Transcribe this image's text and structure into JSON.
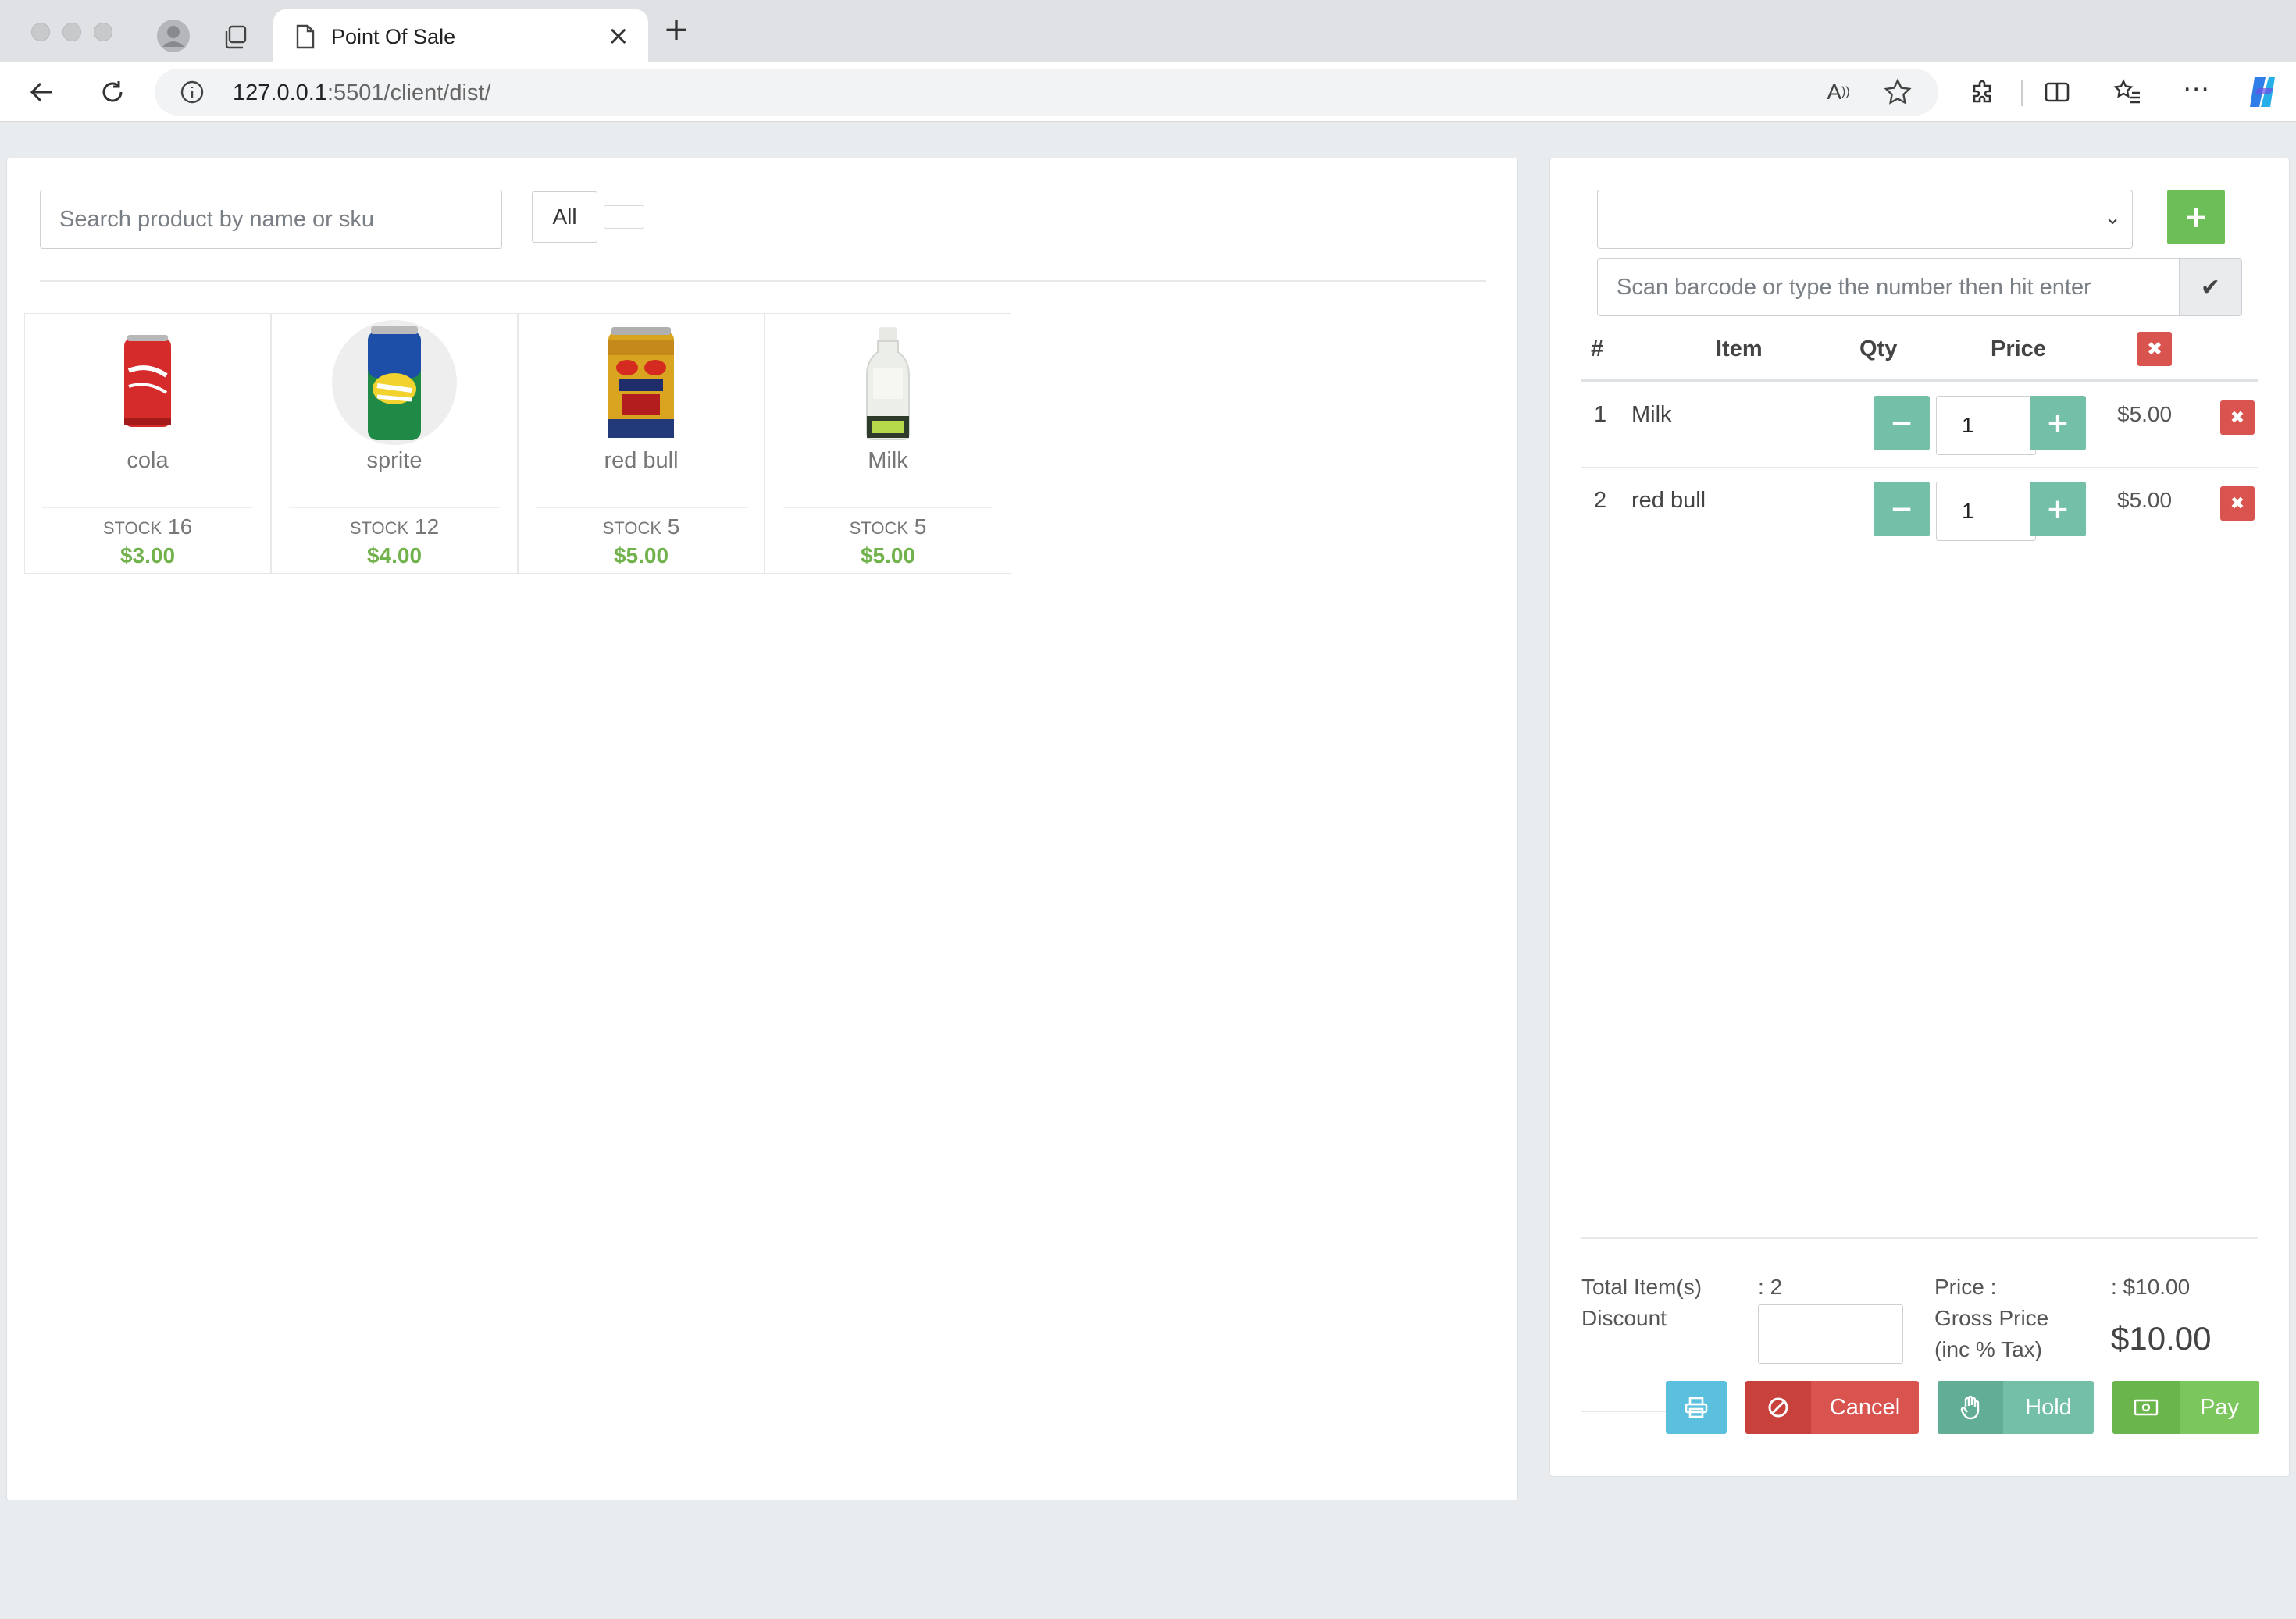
{
  "browser": {
    "tab_title": "Point Of Sale",
    "url_host": "127.0.0.1",
    "url_path": ":5501/client/dist/"
  },
  "products_panel": {
    "search_placeholder": "Search product by name or sku",
    "category_all": "All",
    "stock_label": "STOCK",
    "products": [
      {
        "name": "cola",
        "stock": "16",
        "price": "$3.00",
        "icon": "cola-can-icon",
        "color": "#d52b2b"
      },
      {
        "name": "sprite",
        "stock": "12",
        "price": "$4.00",
        "icon": "sprite-can-icon",
        "color": "#2a7d3c"
      },
      {
        "name": "red bull",
        "stock": "5",
        "price": "$5.00",
        "icon": "red-bull-can-icon",
        "color": "#d9a520"
      },
      {
        "name": "Milk",
        "stock": "5",
        "price": "$5.00",
        "icon": "milk-bottle-icon",
        "color": "#eceeea"
      }
    ]
  },
  "cart": {
    "barcode_placeholder": "Scan barcode or type the number then hit enter",
    "headers": {
      "num": "#",
      "item": "Item",
      "qty": "Qty",
      "price": "Price"
    },
    "items": [
      {
        "num": "1",
        "name": "Milk",
        "qty": "1",
        "price": "$5.00"
      },
      {
        "num": "2",
        "name": "red bull",
        "qty": "1",
        "price": "$5.00"
      }
    ],
    "summary": {
      "total_items_label": "Total Item(s)",
      "total_items_value": ": 2",
      "discount_label": "Discount",
      "price_label": "Price :",
      "price_value": ": $10.00",
      "gross_label_line1": "Gross Price",
      "gross_label_line2": "(inc % Tax)",
      "gross_value": "$10.00"
    },
    "actions": {
      "cancel": "Cancel",
      "hold": "Hold",
      "pay": "Pay"
    }
  },
  "colors": {
    "green": "#6cbf57",
    "teal": "#74bfa8",
    "red": "#d9534f",
    "info": "#5bc0de",
    "price_green": "#72b24d"
  }
}
